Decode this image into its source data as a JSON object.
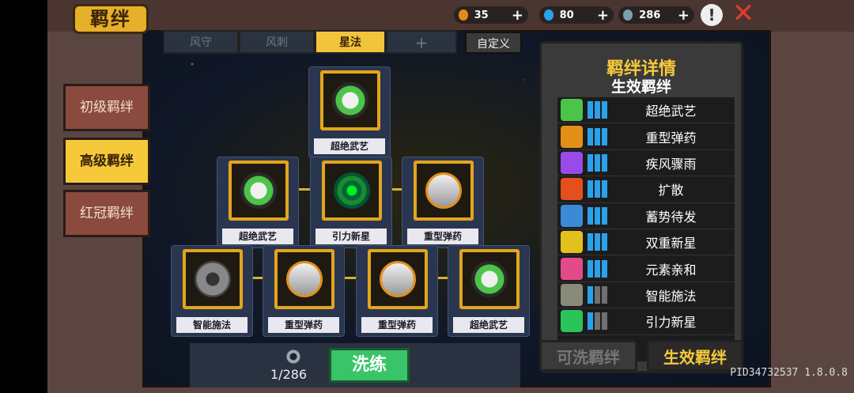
{
  "title": "羁绊",
  "resources": [
    {
      "name": "fire-resource",
      "value": "35",
      "color": "#e38a1c"
    },
    {
      "name": "gem-resource",
      "value": "80",
      "color": "#2aa2ea"
    },
    {
      "name": "coin-resource",
      "value": "286",
      "color": "#7aa0b0"
    }
  ],
  "tabs": [
    {
      "label": "风守"
    },
    {
      "label": "风刺"
    },
    {
      "label": "星法"
    },
    {
      "label": "+"
    },
    {
      "label": "自定义"
    }
  ],
  "side_tabs": [
    {
      "label": "初级羁绊"
    },
    {
      "label": "高级羁绊"
    },
    {
      "label": "红冠羁绊"
    }
  ],
  "tree": {
    "top": {
      "label": "超绝武艺",
      "icon": "sword-icon"
    },
    "mid": [
      {
        "label": "超绝武艺",
        "icon": "sword-icon"
      },
      {
        "label": "引力新星",
        "icon": "gravity-icon"
      },
      {
        "label": "重型弹药",
        "icon": "bullet-icon"
      }
    ],
    "bottom": [
      {
        "label": "智能施法",
        "icon": "gear-icon"
      },
      {
        "label": "重型弹药",
        "icon": "bullet-icon"
      },
      {
        "label": "重型弹药",
        "icon": "bullet-icon"
      },
      {
        "label": "超绝武艺",
        "icon": "sword-icon"
      }
    ]
  },
  "detail": {
    "title": "羁绊详情",
    "subtitle": "生效羁绊",
    "items": [
      {
        "label": "超绝武艺",
        "active": 3,
        "icon_color": "#4cc44a"
      },
      {
        "label": "重型弹药",
        "active": 3,
        "icon_color": "#e39018"
      },
      {
        "label": "疾风骤雨",
        "active": 3,
        "icon_color": "#9a4ae8"
      },
      {
        "label": "扩散",
        "active": 3,
        "icon_color": "#e3501c"
      },
      {
        "label": "蓄势待发",
        "active": 3,
        "icon_color": "#3a8ad8"
      },
      {
        "label": "双重新星",
        "active": 3,
        "icon_color": "#e3c11c"
      },
      {
        "label": "元素亲和",
        "active": 3,
        "icon_color": "#e34a8a"
      },
      {
        "label": "智能施法",
        "active": 1,
        "icon_color": "#8a8a7a"
      },
      {
        "label": "引力新星",
        "active": 1,
        "icon_color": "#2ac45a"
      }
    ]
  },
  "bottom_tabs": {
    "left": "可洗羁绊",
    "right": "生效羁绊"
  },
  "refine": {
    "cost": "1/286",
    "button": "洗练"
  },
  "pid": "PID34732537 1.8.0.8"
}
